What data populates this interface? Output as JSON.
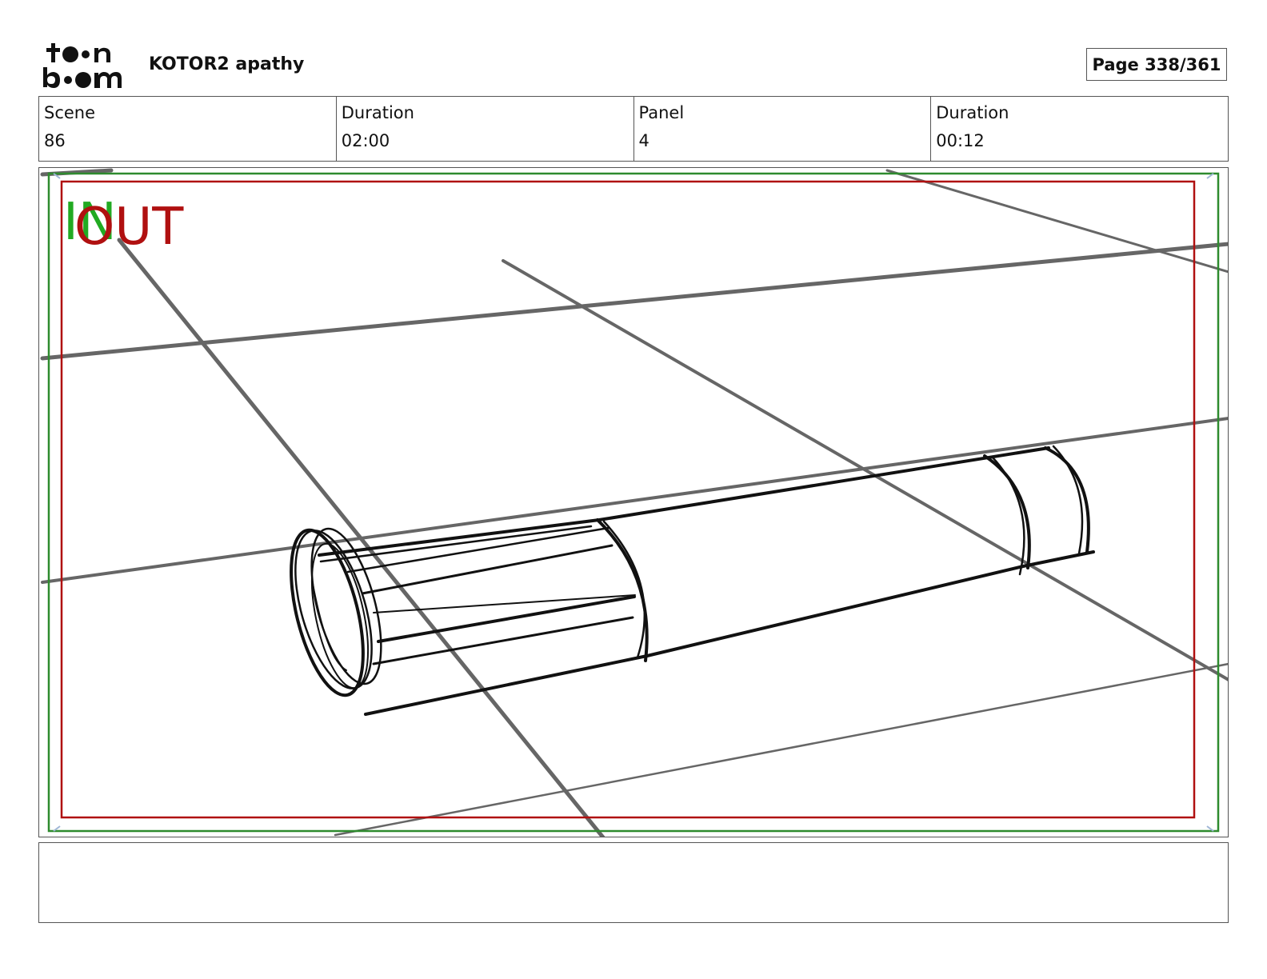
{
  "header": {
    "logo": "toon boom",
    "project_title": "KOTOR2 apathy",
    "page_label": "Page 338/361"
  },
  "info": {
    "scene_label": "Scene",
    "scene_value": "86",
    "scene_duration_label": "Duration",
    "scene_duration_value": "02:00",
    "panel_label": "Panel",
    "panel_value": "4",
    "panel_duration_label": "Duration",
    "panel_duration_value": "00:12"
  },
  "panel": {
    "in_marker": "IN",
    "out_marker": "OUT",
    "colors": {
      "safe_frame": "#2e8b2e",
      "action_frame": "#b01010",
      "perspective_lines": "#666666",
      "sketch": "#111111"
    }
  },
  "notes": {
    "text": ""
  }
}
